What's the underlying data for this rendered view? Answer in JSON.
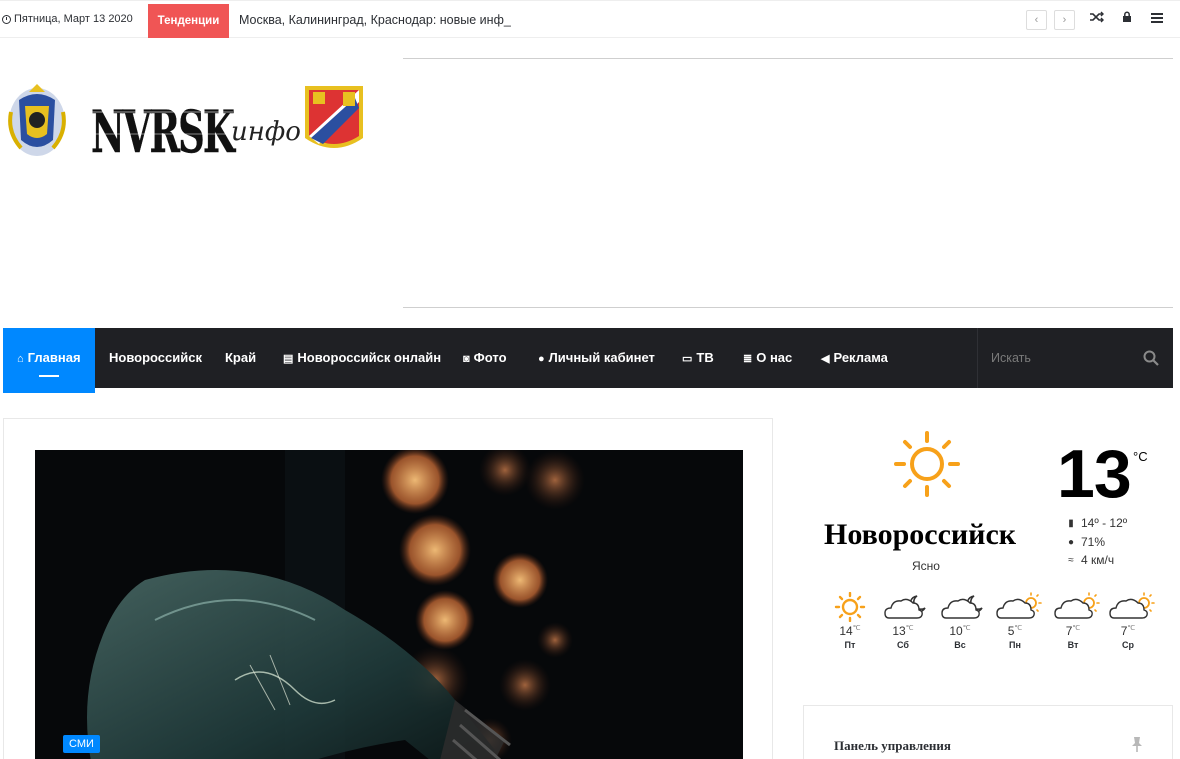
{
  "topbar": {
    "date": "Пятница, Март 13 2020",
    "trending_label": "Тенденции",
    "ticker_text": "Москва, Калининград, Краснодар: новые инф_"
  },
  "nav": {
    "items": [
      {
        "label": "Главная",
        "icon": "home-icon",
        "active": true
      },
      {
        "label": "Новороссийск",
        "icon": ""
      },
      {
        "label": "Край",
        "icon": ""
      },
      {
        "label": "Новороссийск онлайн",
        "icon": "file-icon"
      },
      {
        "label": "Фото",
        "icon": "camera-icon"
      },
      {
        "label": "Личный кабинет",
        "icon": "user-icon"
      },
      {
        "label": "ТВ",
        "icon": "monitor-icon"
      },
      {
        "label": "О нас",
        "icon": "list-icon"
      },
      {
        "label": "Реклама",
        "icon": "megaphone-icon"
      }
    ],
    "search_placeholder": "Искать"
  },
  "article": {
    "category": "СМИ"
  },
  "weather": {
    "temperature": "13",
    "unit": "°C",
    "city": "Новороссийск",
    "condition": "Ясно",
    "temp_range": "14º - 12º",
    "humidity": "71%",
    "wind": "4 км/ч",
    "forecast": [
      {
        "temp": "14",
        "unit": "℃",
        "day": "Пт",
        "icon": "sun-icon"
      },
      {
        "temp": "13",
        "unit": "℃",
        "day": "Сб",
        "icon": "cloud-moon-icon"
      },
      {
        "temp": "10",
        "unit": "℃",
        "day": "Вс",
        "icon": "cloud-moon-icon"
      },
      {
        "temp": "5",
        "unit": "℃",
        "day": "Пн",
        "icon": "cloud-sun-icon"
      },
      {
        "temp": "7",
        "unit": "℃",
        "day": "Вт",
        "icon": "cloud-sun-icon"
      },
      {
        "temp": "7",
        "unit": "℃",
        "day": "Ср",
        "icon": "cloud-sun-icon"
      }
    ]
  },
  "widget": {
    "title": "Панель управления"
  },
  "logo": {
    "text": "NVRSK",
    "suffix": "инфо"
  },
  "colors": {
    "accent": "#0088ff",
    "trending": "#f05555",
    "nav_bg": "#1f2024",
    "sun": "#f7a11a"
  }
}
